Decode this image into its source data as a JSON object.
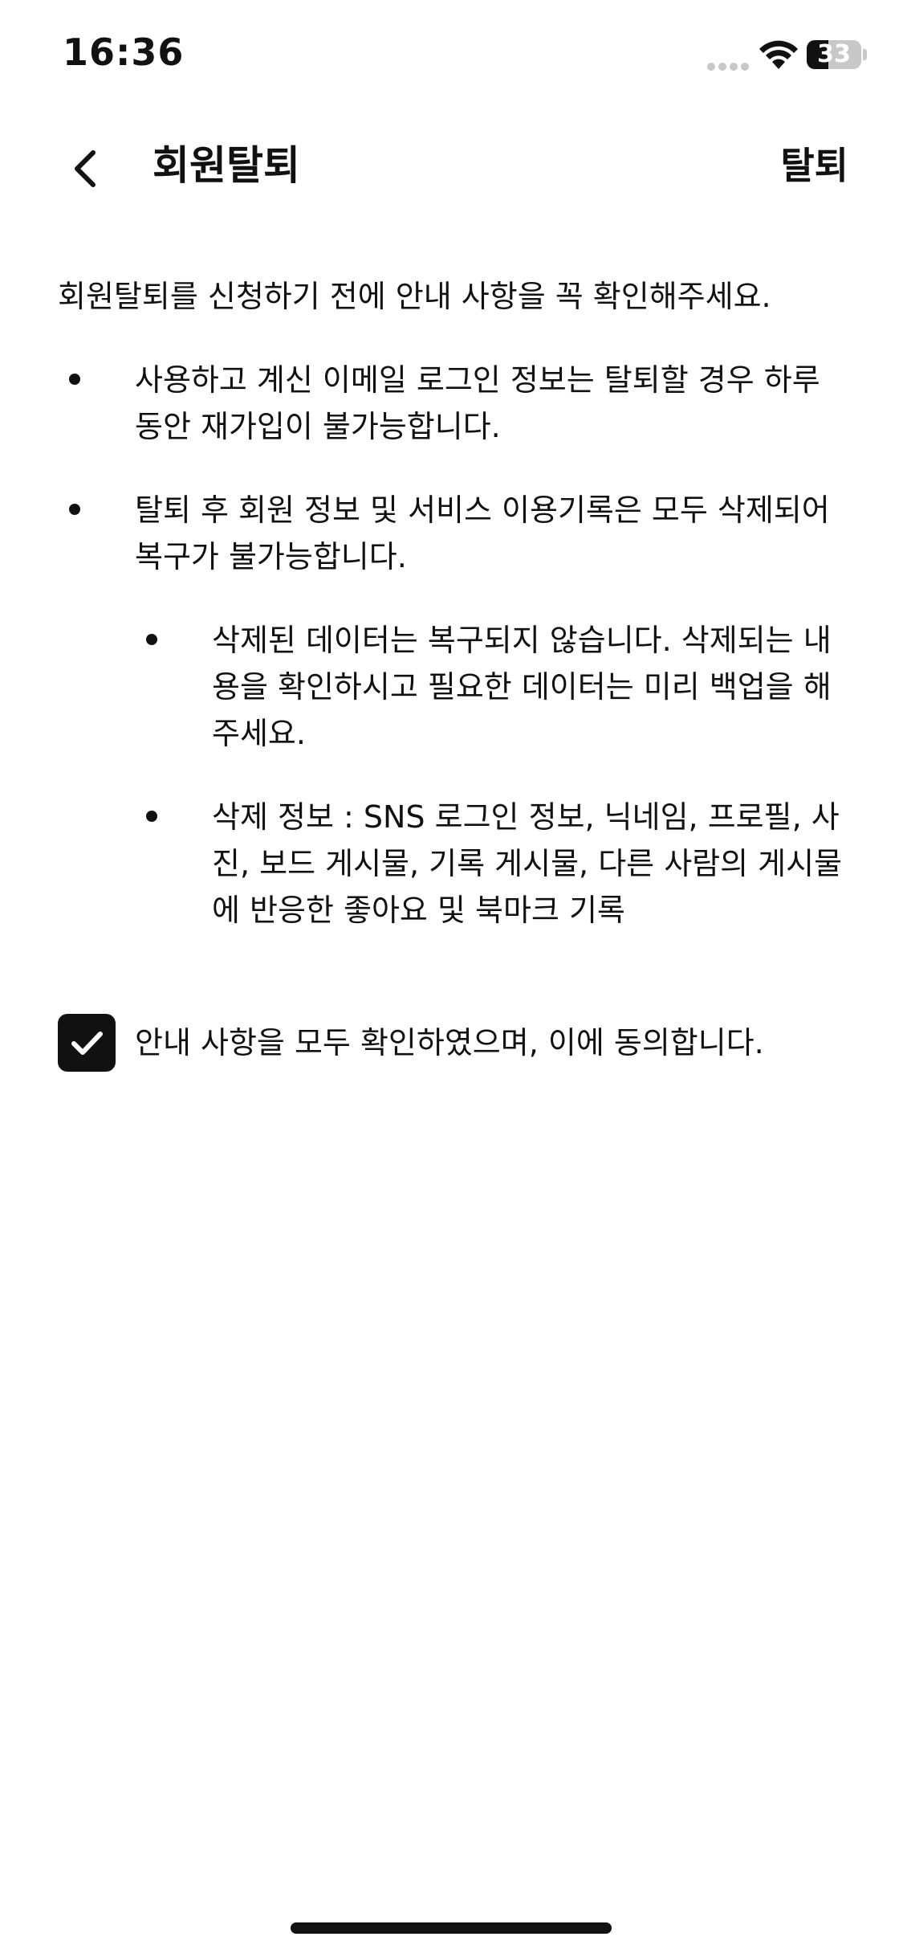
{
  "status_bar": {
    "time": "16:36",
    "battery_level": "33",
    "icons": [
      "signal-icon",
      "wifi-icon",
      "battery-icon"
    ]
  },
  "nav": {
    "back_icon": "chevron-left-icon",
    "title": "회원탈퇴",
    "action_label": "탈퇴"
  },
  "content": {
    "intro": "회원탈퇴를 신청하기 전에 안내 사항을 꼭 확인해주세요.",
    "bullets": [
      {
        "text": "사용하고 계신 이메일 로그인 정보는 탈퇴할 경우 하루 동안 재가입이 불가능합니다."
      },
      {
        "text": "탈퇴 후 회원 정보 및 서비스 이용기록은 모두 삭제되어 복구가 불가능합니다."
      }
    ],
    "sub_bullets": [
      {
        "text": "삭제된 데이터는 복구되지 않습니다. 삭제되는 내용을 확인하시고 필요한 데이터는 미리 백업을 해주세요."
      },
      {
        "text": "삭제 정보 : SNS 로그인 정보, 닉네임, 프로필, 사진, 보드 게시물, 기록 게시물, 다른 사람의 게시물에 반응한 좋아요 및 북마크 기록"
      }
    ]
  },
  "agreement": {
    "checked": true,
    "label": "안내 사항을 모두 확인하였으며, 이에 동의합니다.",
    "icon": "checkmark-icon"
  },
  "colors": {
    "text": "#111111",
    "background": "#ffffff",
    "checkbox_fill": "#111111",
    "battery_empty": "#c8c8c8"
  }
}
